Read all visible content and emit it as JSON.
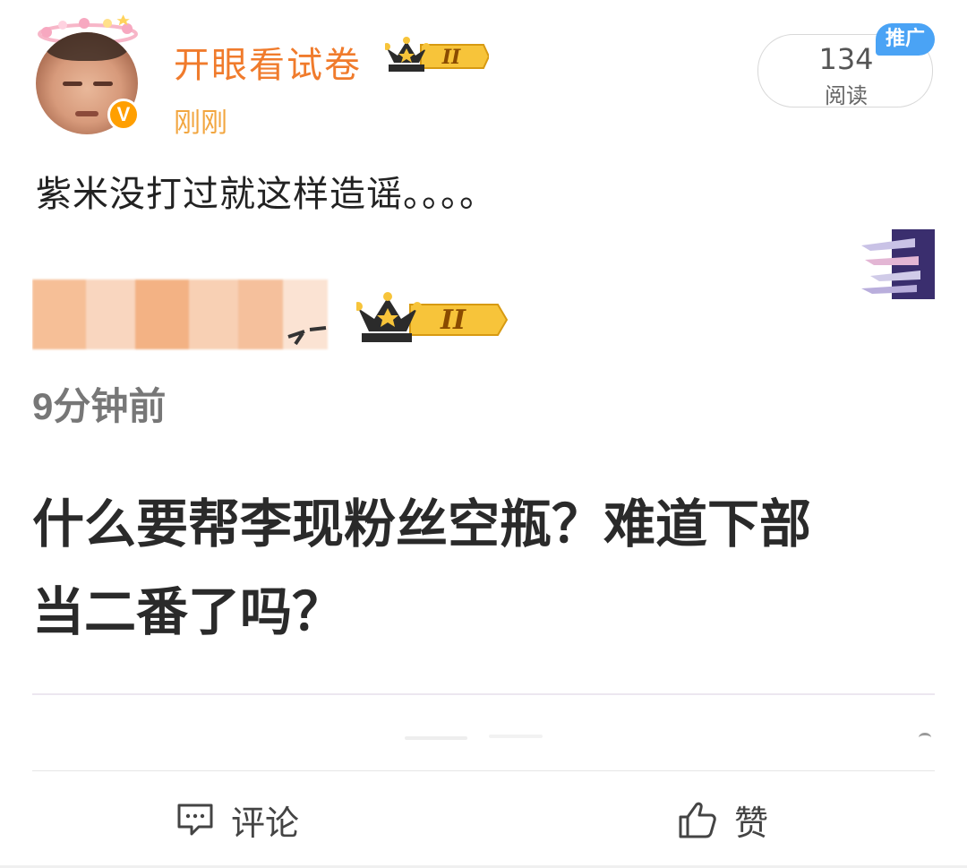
{
  "post": {
    "author": "开眼看试卷",
    "time": "刚刚",
    "verified_badge": "V",
    "level_badge": "II",
    "read_count": "134",
    "read_label": "阅读",
    "promo_label": "推广",
    "text": "紫米没打过就这样造谣。。。。"
  },
  "embedded": {
    "level_badge": "II",
    "time": "9分钟前",
    "line1": "什么要帮李现粉丝空瓶？难道下部",
    "line2": "当二番了吗？"
  },
  "actions": {
    "comment_label": "评论",
    "like_label": "赞"
  },
  "colors": {
    "author": "#f07b2c",
    "time": "#f2a640",
    "promo": "#4aa3f5",
    "badge_gold": "#f7c43a"
  },
  "icons": [
    "crown-badge-icon",
    "verified-v-icon",
    "comment-icon",
    "thumbs-up-icon"
  ]
}
